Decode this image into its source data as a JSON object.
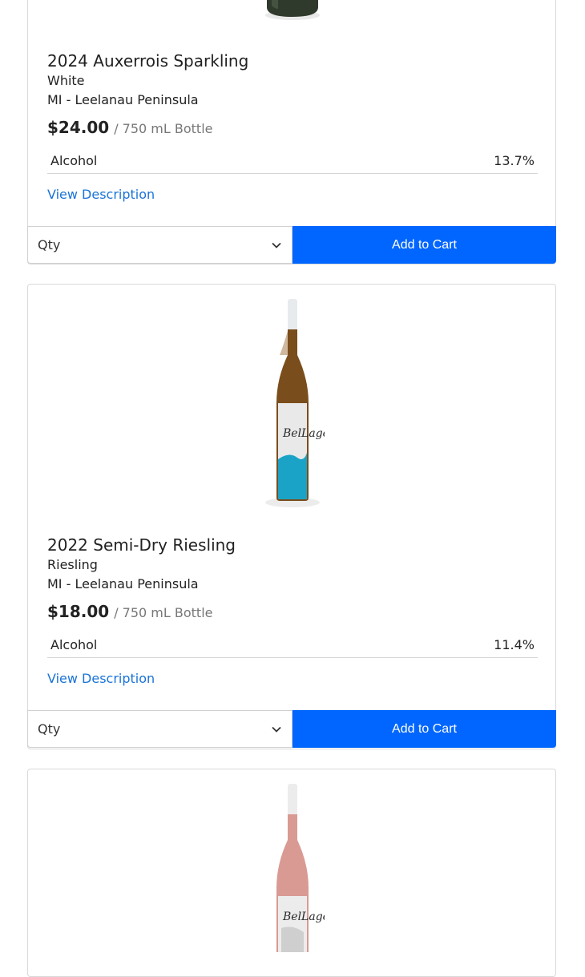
{
  "products": [
    {
      "title": "2024 Auxerrois Sparkling",
      "varietal": "White",
      "region": "MI - Leelanau Peninsula",
      "price": "$24.00",
      "unit": "/ 750 mL Bottle",
      "spec_label": "Alcohol",
      "spec_value": "13.7%",
      "desc_link": "View Description",
      "qty_label": "Qty",
      "cart_label": "Add to Cart"
    },
    {
      "title": "2022 Semi-Dry Riesling",
      "varietal": "Riesling",
      "region": "MI - Leelanau Peninsula",
      "price": "$18.00",
      "unit": "/ 750 mL Bottle",
      "spec_label": "Alcohol",
      "spec_value": "11.4%",
      "desc_link": "View Description",
      "qty_label": "Qty",
      "cart_label": "Add to Cart"
    }
  ],
  "colors": {
    "accent": "#0066ff",
    "link": "#1a73d9",
    "border": "#d9d9d9"
  },
  "icons": [
    "chevron-down-icon",
    "wine-bottle-image"
  ]
}
